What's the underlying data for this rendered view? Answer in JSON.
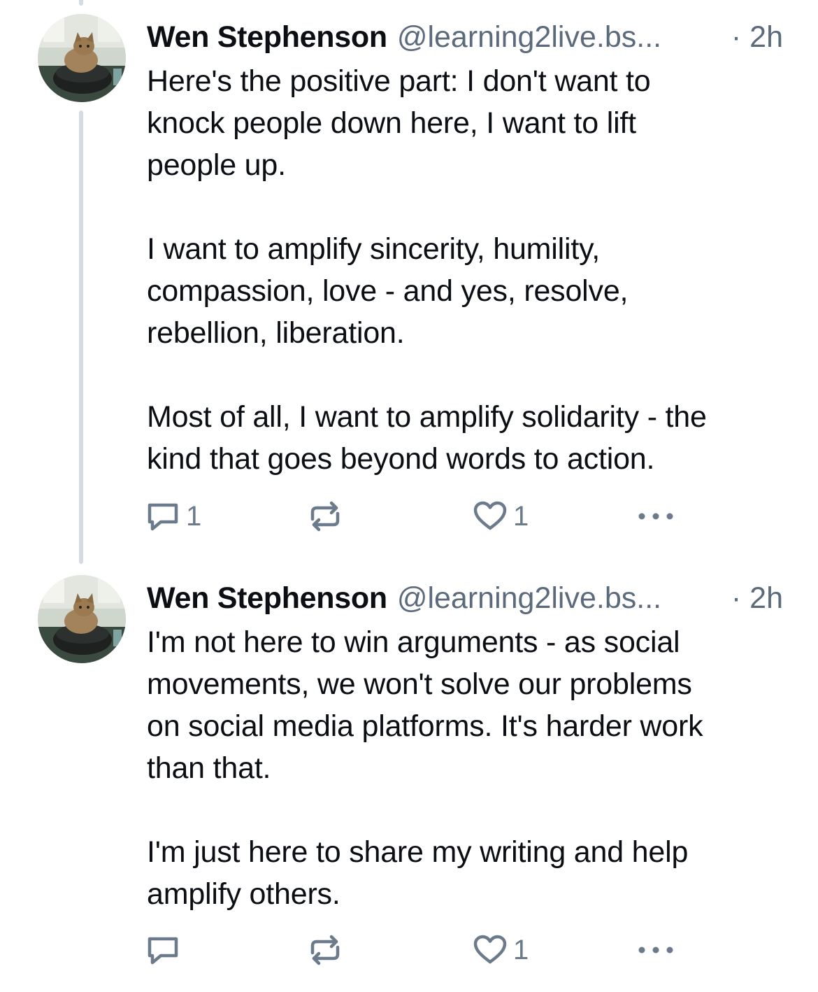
{
  "posts": [
    {
      "author": "Wen Stephenson",
      "handle": "@learning2live.bs...",
      "time": "· 2h",
      "body": "Here's the positive part: I don't want to\nknock people down here, I want to lift\npeople up.\n\nI want to amplify sincerity, humility,\ncompassion, love - and yes, resolve,\nrebellion, liberation.\n\nMost of all, I want to amplify solidarity - the\nkind that goes beyond words to action.",
      "reply_count": "1",
      "repost_count": "",
      "like_count": "1",
      "avatar_icon": "cat-avatar-icon"
    },
    {
      "author": "Wen Stephenson",
      "handle": "@learning2live.bs...",
      "time": "· 2h",
      "body": "I'm not here to win arguments - as social\nmovements, we won't solve our problems\non social media platforms. It's harder work\nthan that.\n\nI'm just here to share my writing and help\namplify others.",
      "reply_count": "",
      "repost_count": "",
      "like_count": "1",
      "avatar_icon": "cat-avatar-icon"
    }
  ],
  "icons": {
    "reply": "reply-icon",
    "repost": "repost-icon",
    "like": "heart-icon",
    "more": "more-options-icon"
  },
  "colors": {
    "text": "#0b0f14",
    "muted": "#5b6b7c",
    "action": "#6b7b8c",
    "thread_line": "#d4dbe2"
  }
}
